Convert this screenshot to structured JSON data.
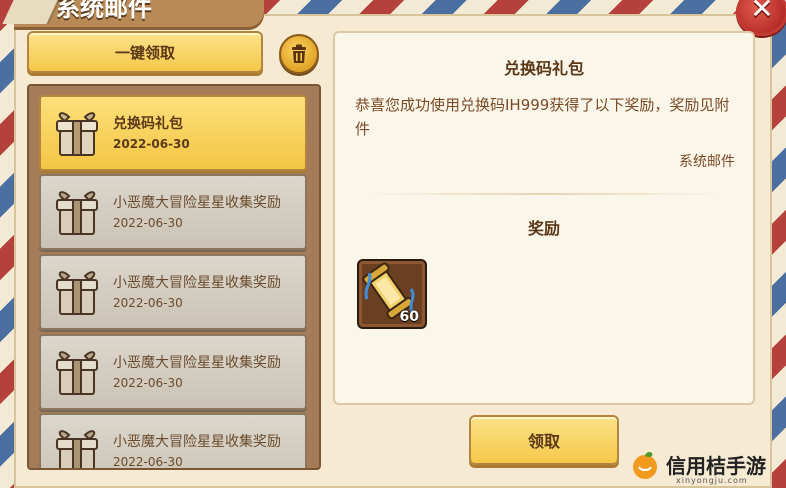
{
  "window": {
    "title": "系统邮件",
    "close_glyph": "✕"
  },
  "toolbar": {
    "claim_all_label": "一键领取",
    "delete_icon": "trash-icon"
  },
  "mail_list": {
    "items": [
      {
        "title": "兑换码礼包",
        "date": "2022-06-30",
        "selected": true,
        "icon": "gift-box-icon"
      },
      {
        "title": "小恶魔大冒险星星收集奖励",
        "date": "2022-06-30",
        "selected": false,
        "icon": "gift-box-icon"
      },
      {
        "title": "小恶魔大冒险星星收集奖励",
        "date": "2022-06-30",
        "selected": false,
        "icon": "gift-box-icon"
      },
      {
        "title": "小恶魔大冒险星星收集奖励",
        "date": "2022-06-30",
        "selected": false,
        "icon": "gift-box-icon"
      },
      {
        "title": "小恶魔大冒险星星收集奖励",
        "date": "2022-06-30",
        "selected": false,
        "icon": "gift-box-icon"
      }
    ]
  },
  "detail": {
    "title": "兑换码礼包",
    "body": "恭喜您成功使用兑换码IH999获得了以下奖励，奖励见附件",
    "sender": "系统邮件",
    "reward_heading": "奖励",
    "rewards": [
      {
        "icon": "scroll-icon",
        "quantity": "60"
      }
    ],
    "claim_label": "领取"
  },
  "watermark": {
    "text": "信用桔手游",
    "subtext": "xinyongju.com"
  },
  "colors": {
    "accent_yellow": "#f5c84a",
    "selected_item": "#fde07a",
    "panel_brown": "#a47c57",
    "close_red": "#b22a25"
  }
}
